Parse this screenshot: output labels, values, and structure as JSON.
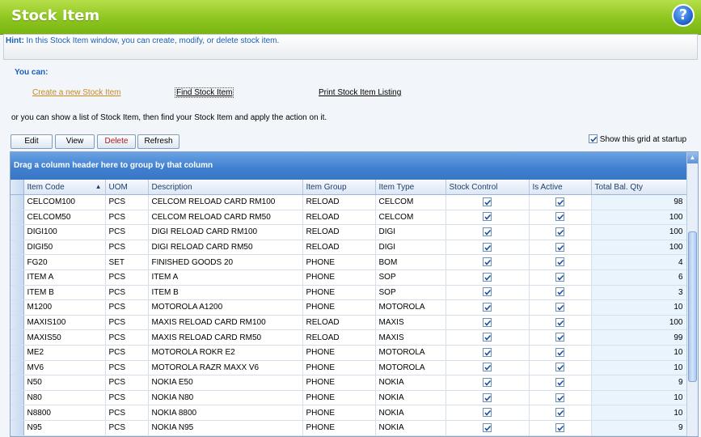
{
  "window": {
    "title": "Stock Item"
  },
  "hint": {
    "label": "Hint:",
    "text": " In this Stock Item window, you can create, modify, or delete stock item."
  },
  "actions": {
    "you_can": "You can:",
    "create": "Create a new Stock Item",
    "find": "Find Stock Item",
    "print": "Print Stock Item Listing",
    "or_text": "or you can show a list of Stock Item, then find your Stock Item and apply the action on it."
  },
  "toolbar": {
    "edit": "Edit",
    "view": "View",
    "delete": "Delete",
    "refresh": "Refresh"
  },
  "startup": {
    "label": "Show this grid at startup",
    "checked": true
  },
  "grid": {
    "group_hint": "Drag a column header here to group by that column",
    "columns": [
      "Item Code",
      "UOM",
      "Description",
      "Item Group",
      "Item Type",
      "Stock Control",
      "Is Active",
      "Total Bal. Qty"
    ],
    "rows": [
      {
        "code": "CELCOM100",
        "uom": "PCS",
        "desc": "CELCOM RELOAD CARD RM100",
        "group": "RELOAD",
        "type": "CELCOM",
        "stock": true,
        "active": true,
        "qty": "98"
      },
      {
        "code": "CELCOM50",
        "uom": "PCS",
        "desc": "CELCOM RELOAD CARD RM50",
        "group": "RELOAD",
        "type": "CELCOM",
        "stock": true,
        "active": true,
        "qty": "100"
      },
      {
        "code": "DIGI100",
        "uom": "PCS",
        "desc": "DIGI RELOAD CARD RM100",
        "group": "RELOAD",
        "type": "DIGI",
        "stock": true,
        "active": true,
        "qty": "100"
      },
      {
        "code": "DIGI50",
        "uom": "PCS",
        "desc": "DIGI RELOAD CARD RM50",
        "group": "RELOAD",
        "type": "DIGI",
        "stock": true,
        "active": true,
        "qty": "100"
      },
      {
        "code": "FG20",
        "uom": "SET",
        "desc": "FINISHED GOODS 20",
        "group": "PHONE",
        "type": "BOM",
        "stock": true,
        "active": true,
        "qty": "4"
      },
      {
        "code": "ITEM A",
        "uom": "PCS",
        "desc": "ITEM A",
        "group": "PHONE",
        "type": "SOP",
        "stock": true,
        "active": true,
        "qty": "6"
      },
      {
        "code": "ITEM B",
        "uom": "PCS",
        "desc": "ITEM B",
        "group": "PHONE",
        "type": "SOP",
        "stock": true,
        "active": true,
        "qty": "3"
      },
      {
        "code": "M1200",
        "uom": "PCS",
        "desc": "MOTOROLA A1200",
        "group": "PHONE",
        "type": "MOTOROLA",
        "stock": true,
        "active": true,
        "qty": "10"
      },
      {
        "code": "MAXIS100",
        "uom": "PCS",
        "desc": "MAXIS RELOAD CARD RM100",
        "group": "RELOAD",
        "type": "MAXIS",
        "stock": true,
        "active": true,
        "qty": "100"
      },
      {
        "code": "MAXIS50",
        "uom": "PCS",
        "desc": "MAXIS RELOAD CARD RM50",
        "group": "RELOAD",
        "type": "MAXIS",
        "stock": true,
        "active": true,
        "qty": "99"
      },
      {
        "code": "ME2",
        "uom": "PCS",
        "desc": "MOTOROLA ROKR E2",
        "group": "PHONE",
        "type": "MOTOROLA",
        "stock": true,
        "active": true,
        "qty": "10"
      },
      {
        "code": "MV6",
        "uom": "PCS",
        "desc": "MOTOROLA RAZR MAXX V6",
        "group": "PHONE",
        "type": "MOTOROLA",
        "stock": true,
        "active": true,
        "qty": "10"
      },
      {
        "code": "N50",
        "uom": "PCS",
        "desc": "NOKIA E50",
        "group": "PHONE",
        "type": "NOKIA",
        "stock": true,
        "active": true,
        "qty": "9"
      },
      {
        "code": "N80",
        "uom": "PCS",
        "desc": "NOKIA N80",
        "group": "PHONE",
        "type": "NOKIA",
        "stock": true,
        "active": true,
        "qty": "10"
      },
      {
        "code": "N8800",
        "uom": "PCS",
        "desc": "NOKIA 8800",
        "group": "PHONE",
        "type": "NOKIA",
        "stock": true,
        "active": true,
        "qty": "10"
      },
      {
        "code": "N95",
        "uom": "PCS",
        "desc": "NOKIA N95",
        "group": "PHONE",
        "type": "NOKIA",
        "stock": true,
        "active": true,
        "qty": "9"
      }
    ]
  },
  "icons": {
    "help": "help-icon",
    "check": "check-icon",
    "sort": "sort-ascending-icon"
  },
  "colors": {
    "title_bar": "#8dc61e",
    "group_panel": "#3f7fd0",
    "qty_column": "#eaf4fc",
    "delete_text": "#b01818"
  }
}
